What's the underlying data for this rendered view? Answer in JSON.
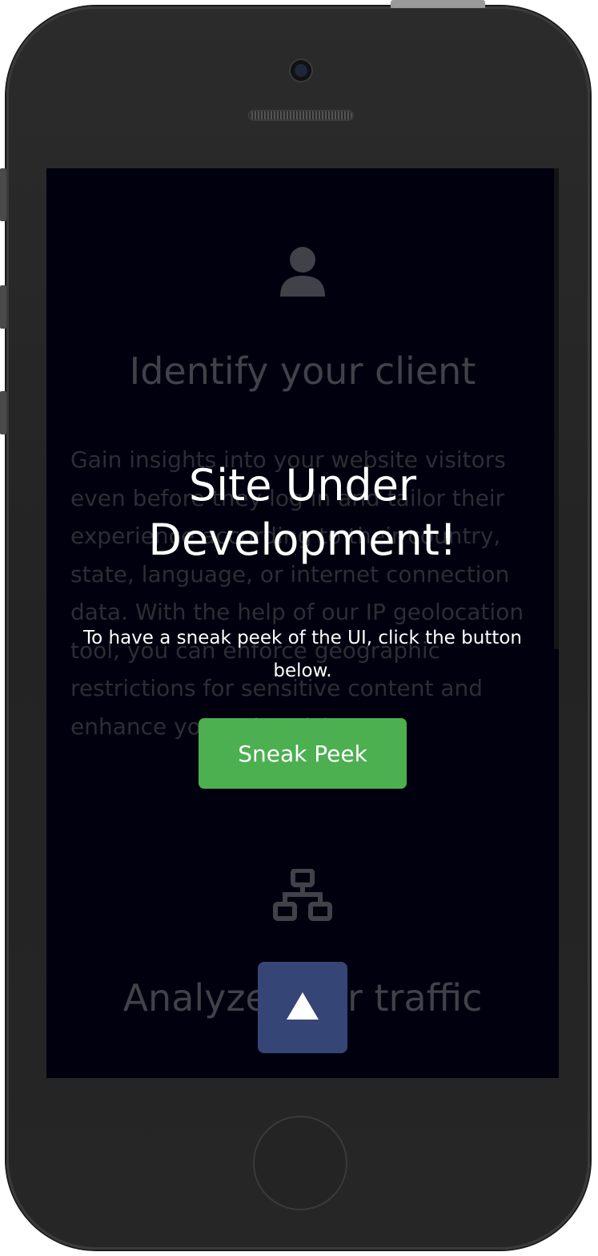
{
  "background": {
    "section1": {
      "icon": "user-icon",
      "heading": "Identify your client",
      "paragraph": "Gain insights into your website visitors even before they log in and tailor their experience according to their country, state, language, or internet connection data. With the help of our IP geolocation tool, you can enforce geographic restrictions for sensitive content and enhance your advertising."
    },
    "section2": {
      "icon": "network-icon",
      "heading": "Analyze your traffic"
    }
  },
  "overlay": {
    "title": "Site Under Development!",
    "subtitle": "To have a sneak peek of the UI, click the button below.",
    "button_label": "Sneak Peek"
  },
  "scroll_top": {
    "icon": "arrow-up-icon"
  },
  "colors": {
    "screen_bg": "#00000f",
    "button_green": "#4caf50",
    "scroll_top_bg": "#354676"
  }
}
